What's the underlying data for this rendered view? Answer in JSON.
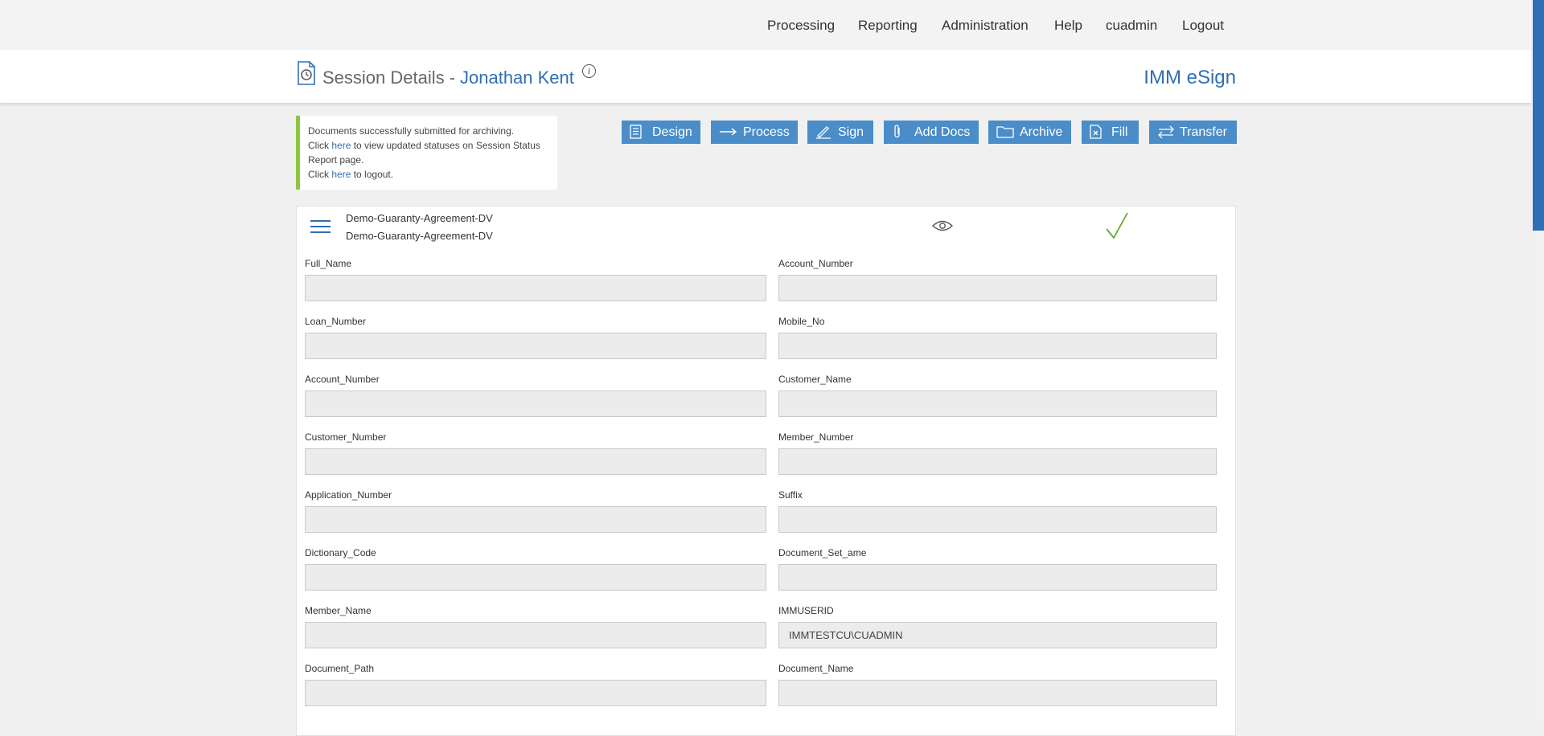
{
  "nav": [
    "Processing",
    "Reporting",
    "Administration",
    "Help",
    "cuadmin",
    "Logout"
  ],
  "header": {
    "title_prefix": "Session Details -",
    "title_name": "Jonathan Kent",
    "brand": "IMM eSign"
  },
  "notice": {
    "line1": "Documents successfully submitted for archiving.",
    "click": "Click",
    "here": "here",
    "line2_rest": "to view updated statuses on Session Status Report page.",
    "line3_rest": "to logout."
  },
  "toolbar": [
    "Design",
    "Process",
    "Sign",
    "Add Docs",
    "Archive",
    "Fill",
    "Transfer"
  ],
  "document": {
    "name": "Demo-Guaranty-Agreement-DV",
    "subname": "Demo-Guaranty-Agreement-DV"
  },
  "fields": {
    "left": [
      {
        "label": "Full_Name",
        "value": ""
      },
      {
        "label": "Loan_Number",
        "value": ""
      },
      {
        "label": "Account_Number",
        "value": ""
      },
      {
        "label": "Customer_Number",
        "value": ""
      },
      {
        "label": "Application_Number",
        "value": ""
      },
      {
        "label": "Dictionary_Code",
        "value": ""
      },
      {
        "label": "Member_Name",
        "value": ""
      },
      {
        "label": "Document_Path",
        "value": ""
      }
    ],
    "right": [
      {
        "label": "Account_Number",
        "value": ""
      },
      {
        "label": "Mobile_No",
        "value": ""
      },
      {
        "label": "Customer_Name",
        "value": ""
      },
      {
        "label": "Member_Number",
        "value": ""
      },
      {
        "label": "Suffix",
        "value": ""
      },
      {
        "label": "Document_Set_ame",
        "value": ""
      },
      {
        "label": "IMMUSERID",
        "value": "IMMTESTCU\\CUADMIN"
      },
      {
        "label": "Document_Name",
        "value": ""
      }
    ]
  },
  "colors": {
    "accent": "#2f6fb5",
    "button": "#4a8dc8",
    "success": "#8dc63f"
  }
}
